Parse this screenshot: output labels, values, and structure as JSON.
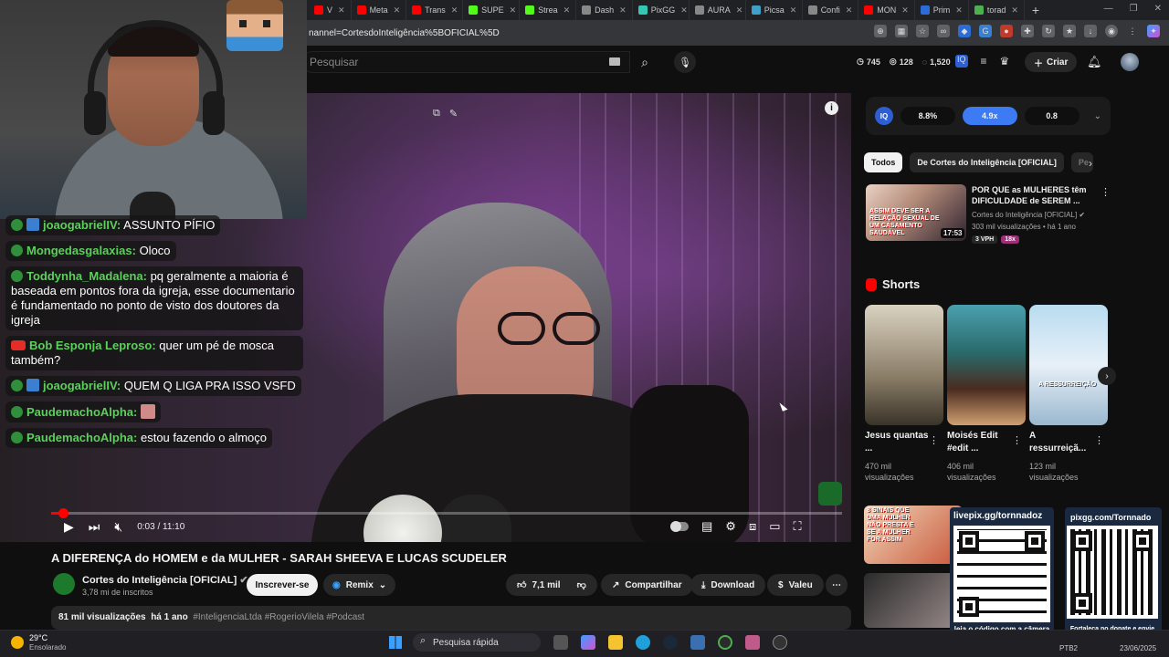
{
  "browser": {
    "tabs": [
      {
        "label": "V",
        "color": "#ff0000"
      },
      {
        "label": "Meta",
        "color": "#ff0000"
      },
      {
        "label": "Trans",
        "color": "#ff0000"
      },
      {
        "label": "SUPE",
        "color": "#53fc18"
      },
      {
        "label": "Strea",
        "color": "#53fc18"
      },
      {
        "label": "Dash",
        "color": "#888888"
      },
      {
        "label": "PixGG",
        "color": "#32c8b4"
      },
      {
        "label": "AURA",
        "color": "#888888"
      },
      {
        "label": "Picsa",
        "color": "#3fa0c8"
      },
      {
        "label": "Confi",
        "color": "#888888"
      },
      {
        "label": "MON",
        "color": "#ff0000"
      },
      {
        "label": "Prim",
        "color": "#2b6cd6"
      },
      {
        "label": "torad",
        "color": "#4caf50"
      }
    ],
    "url": "nannel=CortesdoInteligência%5BOFICIAL%5D"
  },
  "header": {
    "search_placeholder": "Pesquisar",
    "stats": [
      {
        "icon": "clock-icon",
        "value": "745"
      },
      {
        "icon": "eye-icon",
        "value": "128"
      },
      {
        "icon": "chat-icon",
        "value": "1,520"
      }
    ],
    "create_label": "Criar"
  },
  "chat": [
    {
      "user": "joaogabrielIV:",
      "text": "ASSUNTO PÍFIO",
      "badge": "twitch-prime"
    },
    {
      "user": "Mongedasgalaxias:",
      "text": "Oloco",
      "badge": "kick"
    },
    {
      "user": "Toddynha_Madalena:",
      "text": "pq geralmente a maioria é baseada em pontos fora da igreja, esse documentario é fundamentado no ponto de visto dos doutores da igreja",
      "badge": "kick"
    },
    {
      "user": "Bob Esponja Leproso:",
      "text": "quer um pé de mosca também?",
      "badge": "youtube"
    },
    {
      "user": "joaogabrielIV:",
      "text": "QUEM Q LIGA PRA ISSO VSFD",
      "badge": "twitch-prime"
    },
    {
      "user": "PaudemachoAlpha:",
      "text": "",
      "badge": "kick",
      "emote": true
    },
    {
      "user": "PaudemachoAlpha:",
      "text": "estou fazendo o almoço",
      "badge": "kick"
    }
  ],
  "player": {
    "time": "0:03 / 11:10",
    "progress": 0.0045
  },
  "video": {
    "title": "A DIFERENÇA do HOMEM e da MULHER - SARAH SHEEVA E LUCAS SCUDELER",
    "channel": "Cortes do Inteligência [OFICIAL]",
    "subscribers": "3,78 mi de inscritos",
    "subscribe_label": "Inscrever-se",
    "remix_label": "Remix",
    "likes": "7,1 mil",
    "share_label": "Compartilhar",
    "download_label": "Download",
    "thanks_label": "Valeu",
    "views": "81 mil visualizações",
    "age": "há 1 ano",
    "tags": "#InteligenciaLtda #RogerioVilela #Podcast"
  },
  "stats_panel": {
    "logo": "IQ",
    "pills": [
      "8.8%",
      "4.9x",
      "0.8"
    ]
  },
  "chips": [
    "Todos",
    "De Cortes do Inteligência [OFICIAL]",
    "Pe"
  ],
  "recommended": {
    "title": "POR QUE as MULHERES têm DIFICULDADE de SEREM ...",
    "channel": "Cortes do Inteligência [OFICIAL]",
    "meta": "303 mil visualizações • há 1 ano",
    "duration": "17:53",
    "thumb_caption": "ASSIM DEVE SER A RELAÇÃO SEXUAL DE UM CASAMENTO SAUDÁVEL",
    "badges": [
      "3 VPH",
      "18x"
    ]
  },
  "shorts": {
    "heading": "Shorts",
    "items": [
      {
        "title": "Jesus quantas ...",
        "views": "470 mil visualizações"
      },
      {
        "title": "Moisés Edit #edit ...",
        "views": "406 mil visualizações"
      },
      {
        "title": "A ressurreiçã...",
        "views": "123 mil visualizações",
        "overlay": "A RESSURREIÇÃO"
      }
    ]
  },
  "lower": {
    "thumb1_caption": "8 SINAIS QUE UMA MULHER NÃO PRESTA E SE A MULHER FOR ASSIM",
    "qr1_label": "livepix.gg/tornnadoz",
    "qr1_caption": "leia o código com a câmera do celular.",
    "qr2_label": "pixgg.com/Tornnado",
    "qr2_caption": "Fortaleça no donate e envie sua mensagem!"
  },
  "taskbar": {
    "temp": "29°C",
    "weather": "Ensolarado",
    "search": "Pesquisa rápida",
    "tray": "PTB2",
    "date": "23/06/2025"
  },
  "colors": {
    "accent": "#ff0000",
    "kick": "#53fc18",
    "chip_active": "#f1f1f1"
  }
}
